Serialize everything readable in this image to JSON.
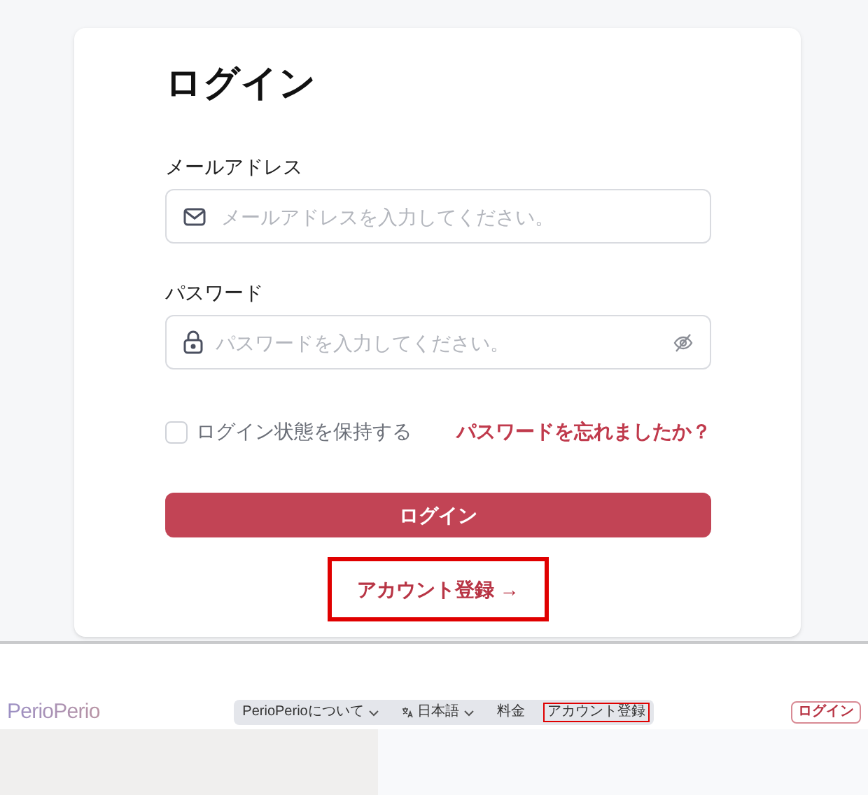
{
  "login_card": {
    "title": "ログイン",
    "fields": [
      {
        "kind": "email",
        "label": "メールアドレス",
        "placeholder": "メールアドレスを入力してください。"
      },
      {
        "kind": "password",
        "label": "パスワード",
        "placeholder": "パスワードを入力してください。"
      }
    ],
    "remember": {
      "label": "ログイン状態を保持する",
      "checked": false
    },
    "forgot_link": "パスワードを忘れましたか？",
    "submit": "ログイン",
    "register_link": {
      "label": "アカウント登録 →",
      "highlighted": true
    }
  },
  "navbar": {
    "logo": "PerioPerio",
    "items": [
      {
        "kind": "dropdown",
        "label": "PerioPerioについて",
        "highlighted": false
      },
      {
        "kind": "language",
        "label": "日本語",
        "highlighted": false
      },
      {
        "kind": "link",
        "label": "料金",
        "highlighted": false
      },
      {
        "kind": "link",
        "label": "アカウント登録",
        "highlighted": true
      }
    ],
    "login_button": "ログイン"
  }
}
